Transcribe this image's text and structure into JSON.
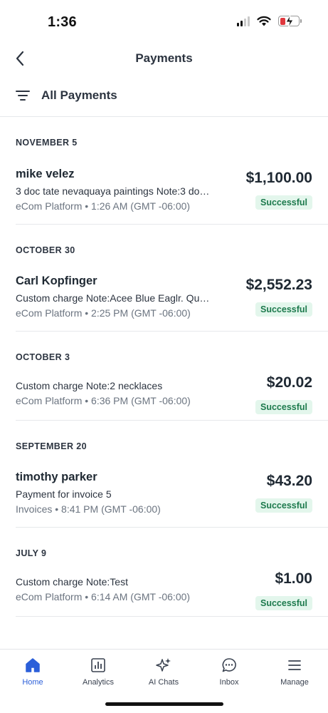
{
  "status_bar": {
    "time": "1:36"
  },
  "header": {
    "title": "Payments"
  },
  "filter": {
    "label": "All Payments"
  },
  "sections": [
    {
      "date": "NOVEMBER 5",
      "items": [
        {
          "name": "mike velez",
          "description": "3 doc tate nevaquaya paintings Note:3 do…",
          "meta": "eCom Platform • 1:26 AM (GMT -06:00)",
          "amount": "$1,100.00",
          "status": "Successful"
        }
      ]
    },
    {
      "date": "OCTOBER 30",
      "items": [
        {
          "name": "Carl Kopfinger",
          "description": "Custom charge Note:Acee Blue Eaglr. Qu…",
          "meta": "eCom Platform • 2:25 PM (GMT -06:00)",
          "amount": "$2,552.23",
          "status": "Successful"
        }
      ]
    },
    {
      "date": "OCTOBER 3",
      "items": [
        {
          "name": "",
          "description": "Custom charge Note:2 necklaces",
          "meta": "eCom Platform • 6:36 PM (GMT -06:00)",
          "amount": "$20.02",
          "status": "Successful"
        }
      ]
    },
    {
      "date": "SEPTEMBER 20",
      "items": [
        {
          "name": "timothy parker",
          "description": "Payment for invoice 5",
          "meta": "Invoices • 8:41 PM (GMT -06:00)",
          "amount": "$43.20",
          "status": "Successful"
        }
      ]
    },
    {
      "date": "JULY 9",
      "items": [
        {
          "name": "",
          "description": "Custom charge Note:Test",
          "meta": "eCom Platform • 6:14 AM (GMT -06:00)",
          "amount": "$1.00",
          "status": "Successful"
        }
      ]
    }
  ],
  "tabs": [
    {
      "label": "Home",
      "icon": "home-icon",
      "active": true
    },
    {
      "label": "Analytics",
      "icon": "analytics-icon",
      "active": false
    },
    {
      "label": "AI Chats",
      "icon": "sparkle-icon",
      "active": false
    },
    {
      "label": "Inbox",
      "icon": "chat-bubble-icon",
      "active": false
    },
    {
      "label": "Manage",
      "icon": "menu-icon",
      "active": false
    }
  ],
  "colors": {
    "accent": "#2b5fd9",
    "success_text": "#1d7a4d",
    "success_bg": "#e3f6ec"
  }
}
